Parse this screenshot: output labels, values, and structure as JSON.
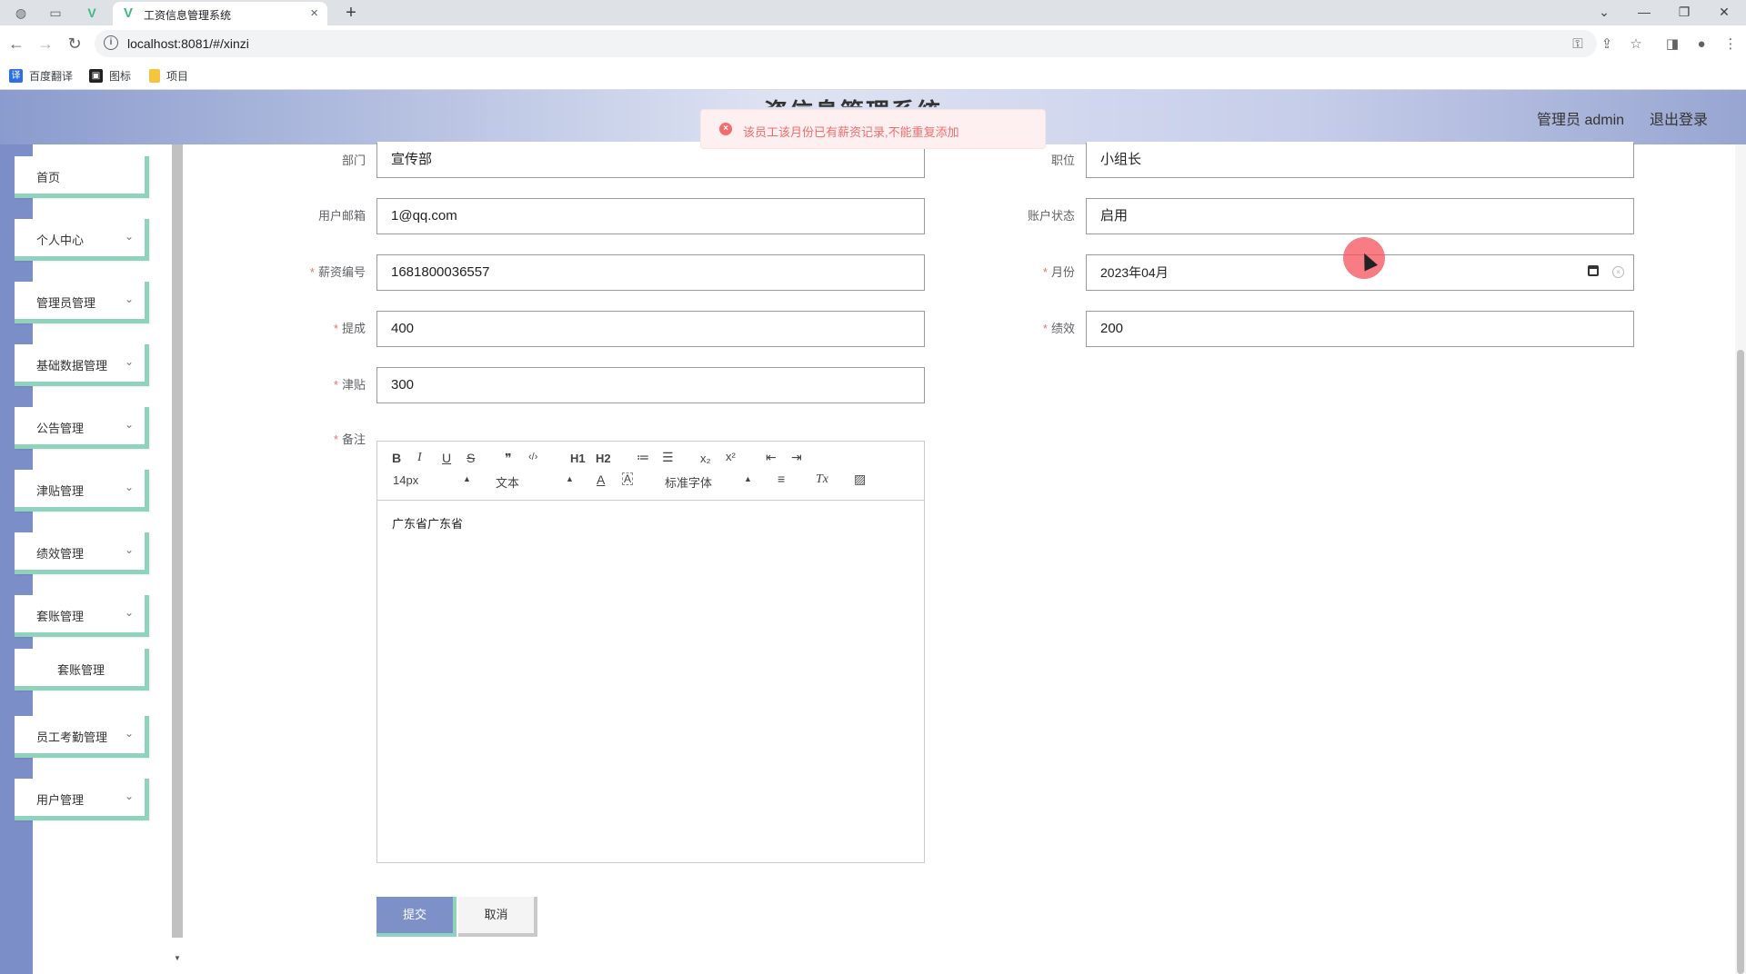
{
  "browser": {
    "tab_title": "工资信息管理系统",
    "tab_close": "×",
    "new_tab": "+",
    "url": "localhost:8081/#/xinzi",
    "bookmarks": [
      {
        "label": "百度翻译",
        "icon": "译",
        "color": "#2f6fe4"
      },
      {
        "label": "图标",
        "icon": "▣",
        "color": "#222222"
      },
      {
        "label": "项目",
        "icon": "",
        "color": "#f5c542"
      }
    ]
  },
  "header": {
    "title": "资信息管理系统",
    "user": "管理员 admin",
    "logout": "退出登录"
  },
  "toast": {
    "message": "该员工该月份已有薪资记录,不能重复添加",
    "color": "#f56c6c"
  },
  "sidebar": {
    "items": [
      {
        "label": "首页",
        "has_arrow": false
      },
      {
        "label": "个人中心",
        "has_arrow": true
      },
      {
        "label": "管理员管理",
        "has_arrow": true
      },
      {
        "label": "基础数据管理",
        "has_arrow": true
      },
      {
        "label": "公告管理",
        "has_arrow": true
      },
      {
        "label": "津贴管理",
        "has_arrow": true
      },
      {
        "label": "绩效管理",
        "has_arrow": true
      },
      {
        "label": "套账管理",
        "has_arrow": true
      },
      {
        "label": "套账管理",
        "has_arrow": false,
        "sub": true
      },
      {
        "label": "员工考勤管理",
        "has_arrow": true
      },
      {
        "label": "用户管理",
        "has_arrow": true
      }
    ]
  },
  "form": {
    "department": {
      "label": "部门",
      "value": "宣传部",
      "required": false
    },
    "position": {
      "label": "职位",
      "value": "小组长",
      "required": false
    },
    "email": {
      "label": "用户邮箱",
      "value": "1@qq.com",
      "required": false
    },
    "account_status": {
      "label": "账户状态",
      "value": "启用",
      "required": false
    },
    "salary_no": {
      "label": "薪资编号",
      "value": "1681800036557",
      "required": true
    },
    "month": {
      "label": "月份",
      "value": "2023年04月",
      "required": true
    },
    "commission": {
      "label": "提成",
      "value": "400",
      "required": true
    },
    "performance": {
      "label": "绩效",
      "value": "200",
      "required": true
    },
    "allowance": {
      "label": "津贴",
      "value": "300",
      "required": true
    },
    "remarks": {
      "label": "备注",
      "value": "广东省广东省",
      "required": true
    },
    "required_mark": "*"
  },
  "editor_toolbar": {
    "bold": "B",
    "italic": "I",
    "underline": "U",
    "strike": "S",
    "quote": "❞",
    "code": "‹/›",
    "h1": "H1",
    "h2": "H2",
    "ordered": "≔",
    "bullet": "☰",
    "sub": "x₂",
    "sup": "x²",
    "outdent": "⇤",
    "indent": "⇥",
    "size": "14px",
    "header": "文本",
    "color": "A",
    "background": "A",
    "font": "标准字体",
    "align": "≡",
    "clean": "Tx",
    "image": "▨"
  },
  "buttons": {
    "submit": "提交",
    "cancel": "取消"
  },
  "colors": {
    "accent": "#7e90c8",
    "menu_border": "#8fd3bd",
    "error": "#f56c6c"
  }
}
